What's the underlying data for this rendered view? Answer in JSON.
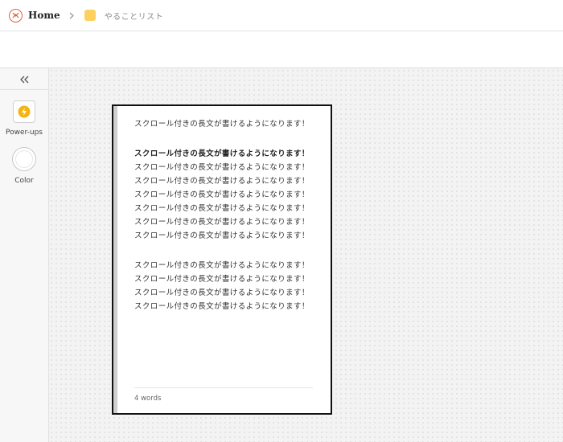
{
  "header": {
    "home_label": "Home",
    "board_label": "やることリスト"
  },
  "sidebar": {
    "powerups_label": "Power-ups",
    "color_label": "Color"
  },
  "note": {
    "para1": "スクロール付きの長文が書けるようになります！",
    "para2_bold": "スクロール付きの長文が書けるようになります！",
    "para2_rest": "スクロール付きの長文が書けるようになります！スクロール付きの長文が書けるようになります！スクロール付きの長文が書けるようになります！スクロール付きの長文が書けるようになります！スクロール付きの長文が書けるようになります！スクロール付きの長文が書けるようになります！",
    "para3": "スクロール付きの長文が書けるようになります！スクロール付きの長文が書けるようになります！スクロール付きの長文が書けるようになります！スクロール付きの長文が書けるようになります！",
    "word_count": "4 words"
  },
  "colors": {
    "accent": "#e2603a",
    "board_icon": "#fdd160",
    "powerup_icon": "#f2b511"
  },
  "icons": [
    "logo-icon",
    "chevron-right-icon",
    "board-color-icon",
    "collapse-double-chevron-icon",
    "lightning-icon",
    "color-circle-icon"
  ]
}
